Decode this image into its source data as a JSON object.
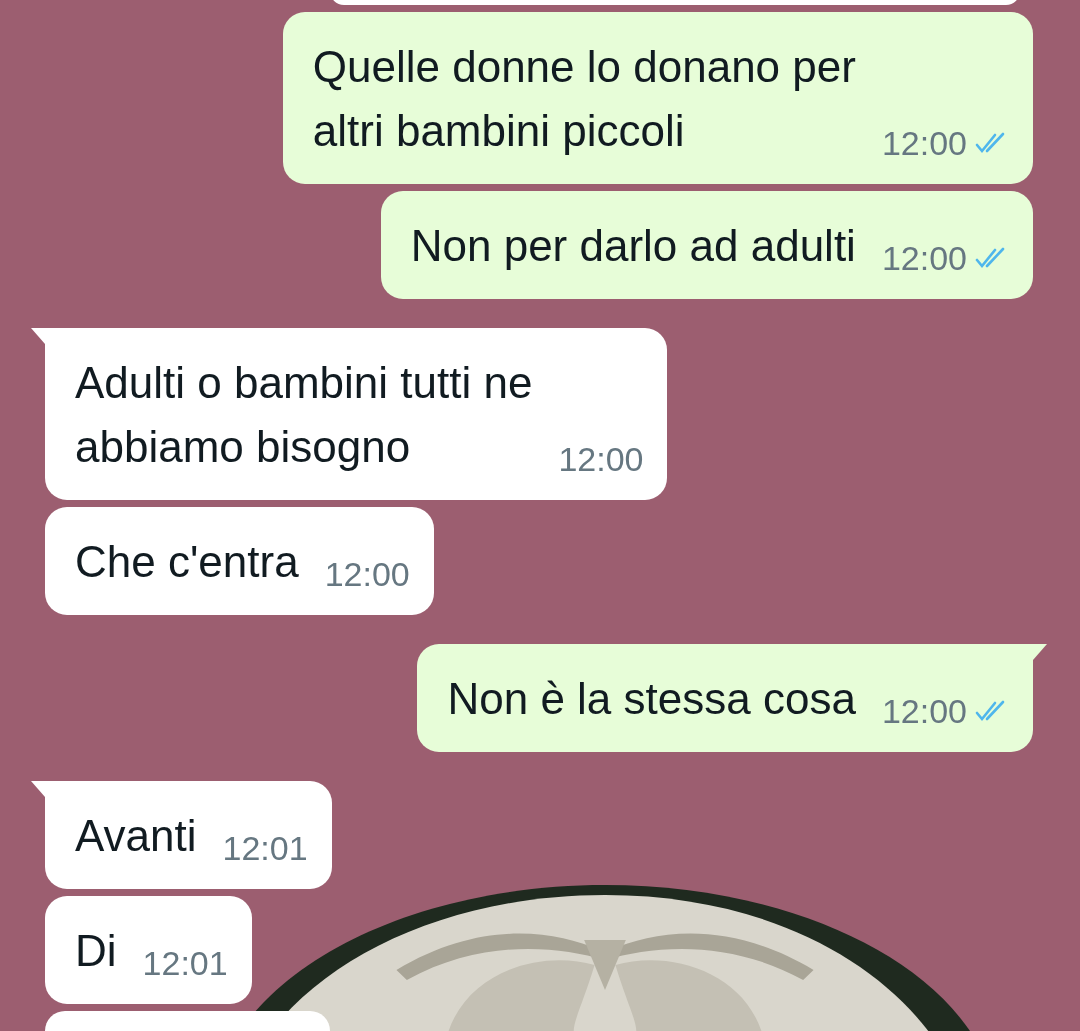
{
  "messages": [
    {
      "kind": "fragment"
    },
    {
      "kind": "outgoing",
      "lines": [
        "Quelle donne lo donano per",
        "altri bambini piccoli"
      ],
      "time": "12:00",
      "tail": false,
      "read": true
    },
    {
      "kind": "outgoing",
      "lines": [
        "Non per darlo ad adulti"
      ],
      "time": "12:00",
      "tail": false,
      "read": true
    },
    {
      "kind": "incoming",
      "lines": [
        "Adulti o bambini tutti ne",
        "abbiamo bisogno"
      ],
      "time": "12:00",
      "tail": true
    },
    {
      "kind": "incoming",
      "lines": [
        "Che c'entra"
      ],
      "time": "12:00",
      "tail": false
    },
    {
      "kind": "outgoing",
      "lines": [
        "Non è la stessa cosa"
      ],
      "time": "12:00",
      "tail": true,
      "read": true
    },
    {
      "kind": "incoming",
      "lines": [
        "Avanti"
      ],
      "time": "12:01",
      "tail": true
    },
    {
      "kind": "incoming",
      "lines": [
        "Di"
      ],
      "time": "12:01",
      "tail": false
    },
    {
      "kind": "fragment"
    }
  ]
}
